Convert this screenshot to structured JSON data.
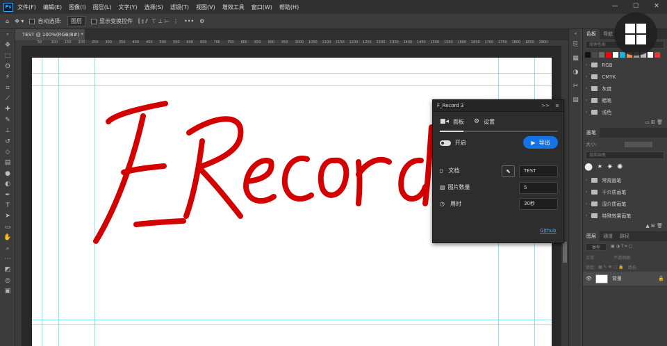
{
  "menubar": {
    "logo": "Ps",
    "items": [
      "文件(F)",
      "编辑(E)",
      "图像(I)",
      "图层(L)",
      "文字(Y)",
      "选择(S)",
      "滤镜(T)",
      "视图(V)",
      "增效工具",
      "窗口(W)",
      "帮助(H)"
    ],
    "window_buttons": [
      "—",
      "☐",
      "✕"
    ]
  },
  "options": {
    "auto_select": "自动选择:",
    "layer_dropdown": "图层",
    "show_transform": "显示变换控件",
    "more": "•••"
  },
  "document": {
    "tab_label": "TEST @ 100%(RGB/8#) *",
    "tab_close": "×"
  },
  "ruler": {
    "ticks": [
      "50",
      "100",
      "150",
      "200",
      "250",
      "300",
      "350",
      "400",
      "450",
      "500",
      "550",
      "600",
      "650",
      "700",
      "750",
      "800",
      "850",
      "900",
      "950",
      "1000",
      "1050",
      "1100",
      "1150",
      "1200",
      "1250",
      "1300",
      "1350",
      "1400",
      "1450",
      "1500",
      "1550",
      "1600",
      "1650",
      "1700",
      "1750",
      "1800",
      "1850",
      "1900"
    ]
  },
  "canvas": {
    "artwork_text": "F_Record",
    "ink_color": "#d40000"
  },
  "right_panel": {
    "swatch_tabs": [
      "色板",
      "导航"
    ],
    "swatch_search": "搜索色板",
    "swatch_colors": [
      "#111111",
      "#4a4a4a",
      "#6b6b6b",
      "#ff0000",
      "#ffffff",
      "#19b3d8",
      "#e98f5b",
      "#9a9a9a",
      "#b8b8b8",
      "#ffffff",
      "#d93a3a"
    ],
    "swatch_folders": [
      "RGB",
      "CMYK",
      "灰度",
      "蜡笔",
      "浅色"
    ],
    "brush_tab": "画笔",
    "brush_size_label": "大小:",
    "brush_search": "搜索画笔",
    "brush_folders": [
      "常规画笔",
      "干介质画笔",
      "湿介质画笔",
      "特殊效果画笔"
    ],
    "layer_tabs": [
      "图层",
      "通道",
      "路径"
    ],
    "layer_kind": "类型",
    "layer_mode": "正常",
    "layer_opacity": "不透明度:",
    "layer_lock": "锁定:",
    "layer_fill": "填充:",
    "layer_name": "背景"
  },
  "frecord": {
    "title": "F_Record 3",
    "header_icons": [
      ">>",
      "≡"
    ],
    "tab_panel": "面板",
    "tab_settings": "设置",
    "toggle_label": "开启",
    "export_label": "导出",
    "doc_label": "文档",
    "doc_value": "TEST",
    "count_label": "图片数量",
    "count_value": "5",
    "time_label": "用时",
    "time_value": "30秒",
    "github": "Github"
  }
}
